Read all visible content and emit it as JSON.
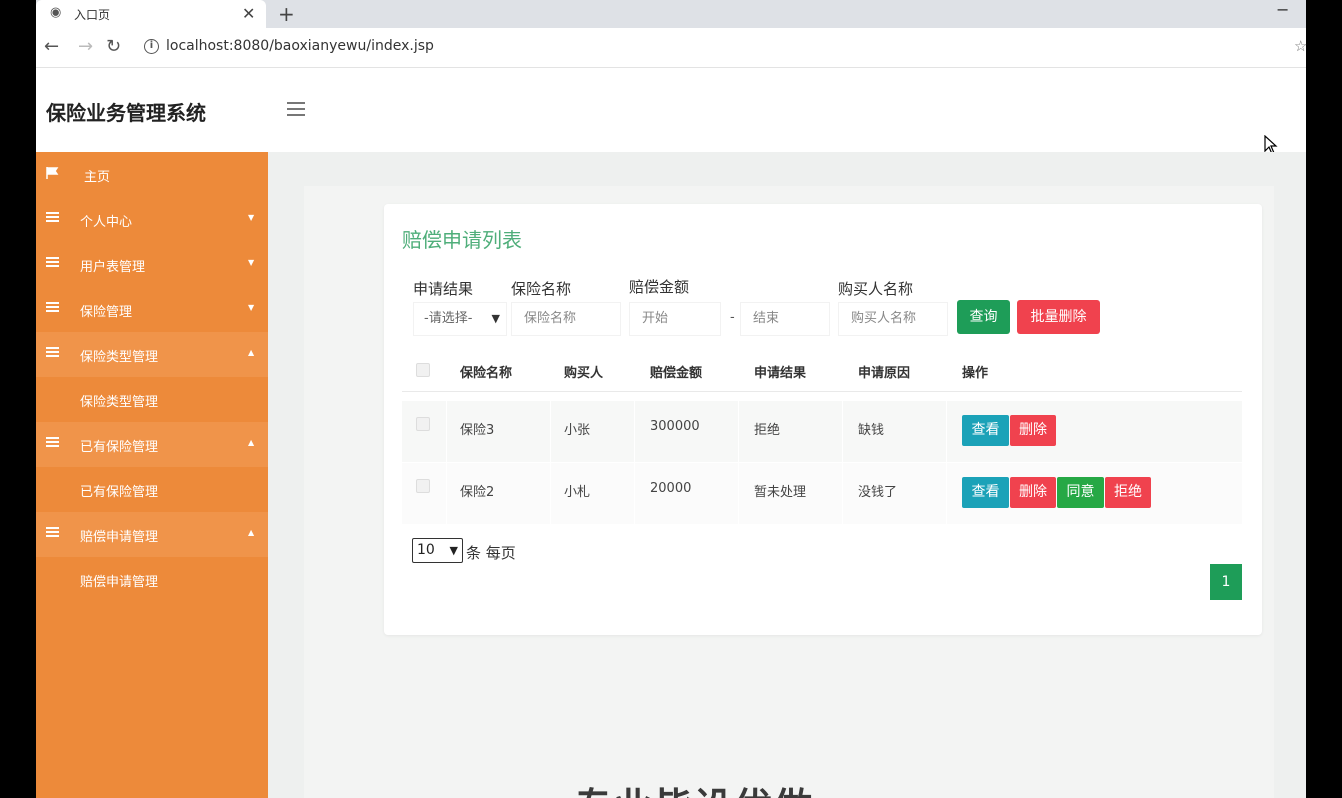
{
  "browser": {
    "tab_title": "入口页",
    "tab_close": "✕",
    "new_tab": "+",
    "minimize": "−",
    "url": "localhost:8080/baoxianyewu/index.jsp"
  },
  "header": {
    "app_title": "保险业务管理系统"
  },
  "sidebar": {
    "items": [
      {
        "label": "主页",
        "icon": "flag-icon"
      },
      {
        "label": "个人中心",
        "icon": "list-icon"
      },
      {
        "label": "用户表管理",
        "icon": "list-icon"
      },
      {
        "label": "保险管理",
        "icon": "list-icon"
      },
      {
        "label": "保险类型管理",
        "icon": "list-icon",
        "open": true,
        "sub": "保险类型管理"
      },
      {
        "label": "已有保险管理",
        "icon": "list-icon",
        "open": true,
        "sub": "已有保险管理"
      },
      {
        "label": "赔偿申请管理",
        "icon": "list-icon",
        "open": true,
        "sub": "赔偿申请管理"
      }
    ],
    "accent_color": "#ed8a3a"
  },
  "panel": {
    "title": "赔偿申请列表",
    "filters": {
      "result_label": "申请结果",
      "result_value": "-请选择-",
      "insurance_label": "保险名称",
      "insurance_placeholder": "保险名称",
      "amount_label": "赔偿金额",
      "amount_start": "开始",
      "amount_sep": "-",
      "amount_end": "结束",
      "buyer_label": "购买人名称",
      "buyer_placeholder": "购买人名称",
      "query_button": "查询",
      "batch_delete_button": "批量删除"
    },
    "table": {
      "columns": [
        "保险名称",
        "购买人",
        "赔偿金额",
        "申请结果",
        "申请原因",
        "操作"
      ],
      "rows": [
        {
          "insurance": "保险3",
          "buyer": "小张",
          "amount": "300000",
          "result": "拒绝",
          "reason": "缺钱",
          "actions": [
            "查看",
            "删除"
          ]
        },
        {
          "insurance": "保险2",
          "buyer": "小札",
          "amount": "20000",
          "result": "暂未处理",
          "reason": "没钱了",
          "actions": [
            "查看",
            "删除",
            "同意",
            "拒绝"
          ]
        }
      ]
    },
    "pagination": {
      "page_size": "10",
      "page_size_text": "条 每页",
      "current_page": "1"
    }
  },
  "footer_heading": "专业皆设优做"
}
